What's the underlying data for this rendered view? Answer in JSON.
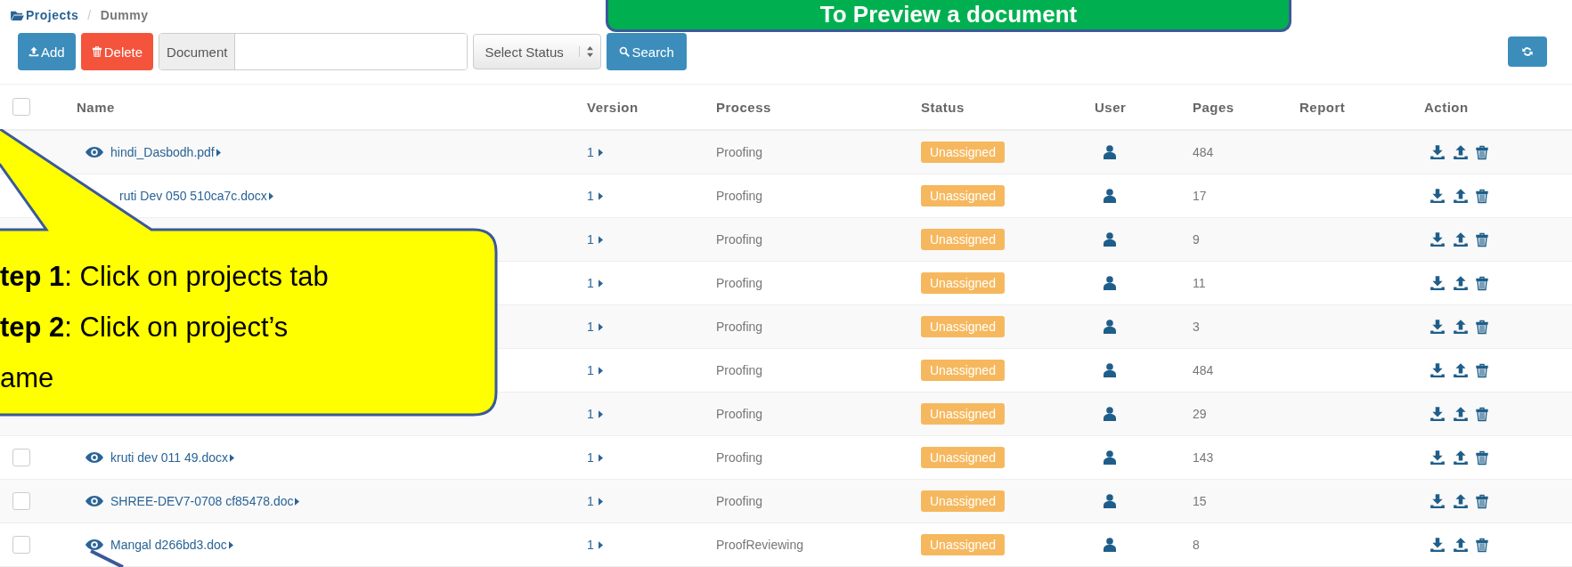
{
  "breadcrumb": {
    "items": [
      {
        "label": "Projects"
      },
      {
        "label": "Dummy"
      }
    ],
    "separator": "/"
  },
  "banner": {
    "text": "To Preview a document"
  },
  "toolbar": {
    "buttons": [
      {
        "label": "Add",
        "kind": "add"
      },
      {
        "label": "Delete",
        "kind": "delete"
      }
    ],
    "document_field": {
      "label": "Document"
    },
    "status_select": {
      "placeholder": "Select Status"
    },
    "search_button": {
      "label": "Search"
    }
  },
  "table": {
    "header_checkbox": {
      "checked": false
    },
    "columns": [
      "Name",
      "Version",
      "Process",
      "Status",
      "User",
      "Pages",
      "Report",
      "Action"
    ],
    "rows": [
      {
        "name": "hindi_Dasbodh.pdf",
        "preview_icon": true,
        "version": "1",
        "process": "Proofing",
        "status": "Unassigned",
        "pages": "484"
      },
      {
        "name": "ruti Dev 050 510ca7c.docx",
        "preview_icon": false,
        "version": "1",
        "process": "Proofing",
        "status": "Unassigned",
        "pages": "17"
      },
      {
        "version": "1",
        "process": "Proofing",
        "status": "Unassigned",
        "pages": "9"
      },
      {
        "version": "1",
        "process": "Proofing",
        "status": "Unassigned",
        "pages": "11"
      },
      {
        "version": "1",
        "process": "Proofing",
        "status": "Unassigned",
        "pages": "3"
      },
      {
        "version": "1",
        "process": "Proofing",
        "status": "Unassigned",
        "pages": "484"
      },
      {
        "version": "1",
        "process": "Proofing",
        "status": "Unassigned",
        "pages": "29"
      },
      {
        "checked": false,
        "name": "kruti dev 011 49.docx",
        "preview_icon": true,
        "version": "1",
        "process": "Proofing",
        "status": "Unassigned",
        "pages": "143"
      },
      {
        "checked": false,
        "name": "SHREE-DEV7-0708 cf85478.doc",
        "preview_icon": true,
        "version": "1",
        "process": "Proofing",
        "status": "Unassigned",
        "pages": "15"
      },
      {
        "checked": false,
        "name": "Mangal d266bd3.doc",
        "preview_icon": true,
        "version": "1",
        "process": "ProofReviewing",
        "status": "Unassigned",
        "pages": "8"
      }
    ]
  },
  "callout": {
    "lines": [
      "**tep 1**: Click on projects tab",
      "**tep 2**: Click on project’s",
      "ame"
    ]
  }
}
